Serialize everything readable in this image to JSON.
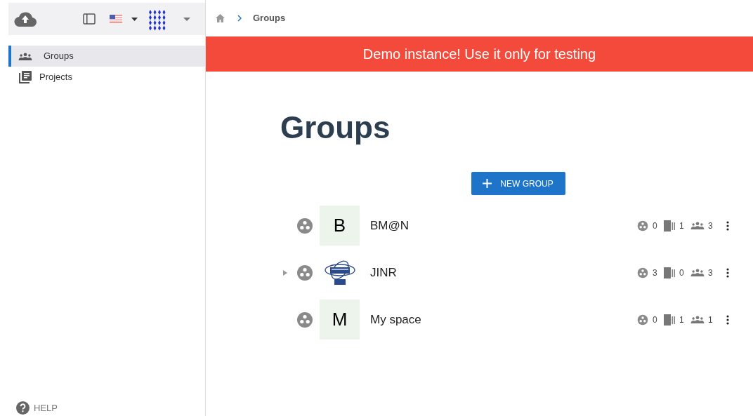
{
  "sidebar": {
    "items": [
      {
        "label": "Groups",
        "kind": "groups",
        "selected": true
      },
      {
        "label": "Projects",
        "kind": "projects",
        "selected": false
      }
    ],
    "help": "HELP"
  },
  "breadcrumb": {
    "current": "Groups"
  },
  "banner": "Demo instance! Use it only for testing",
  "page_title": "Groups",
  "new_button": "NEW GROUP",
  "groups": [
    {
      "name": "BM@N",
      "avatar": {
        "kind": "letter",
        "letter": "B"
      },
      "expandable": false,
      "subgroups": "0",
      "projects": "1",
      "members": "3"
    },
    {
      "name": "JINR",
      "avatar": {
        "kind": "logo"
      },
      "expandable": true,
      "subgroups": "3",
      "projects": "0",
      "members": "3"
    },
    {
      "name": "My space",
      "avatar": {
        "kind": "letter",
        "letter": "M"
      },
      "expandable": false,
      "subgroups": "0",
      "projects": "1",
      "members": "1"
    }
  ]
}
